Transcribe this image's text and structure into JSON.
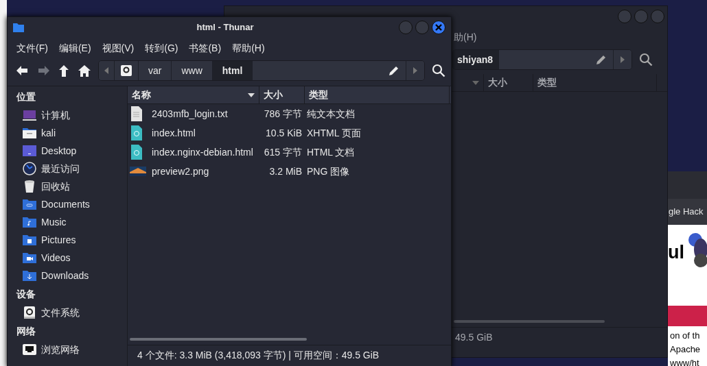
{
  "back_window": {
    "menu_item": "助(H)",
    "path_segment": "shiyan8",
    "columns": [
      "大小",
      "类型"
    ],
    "status": "49.5 GiB"
  },
  "browser_window": {
    "tab": "gle Hack",
    "heading": "ul",
    "lines": [
      "on of th",
      "Apache",
      "www/ht"
    ]
  },
  "window": {
    "title": "html - Thunar"
  },
  "menu": [
    "文件(F)",
    "编辑(E)",
    "视图(V)",
    "转到(G)",
    "书签(B)",
    "帮助(H)"
  ],
  "nav_buttons": [
    {
      "kind": "back",
      "disabled": false
    },
    {
      "kind": "forward",
      "disabled": true
    },
    {
      "kind": "up",
      "disabled": false
    },
    {
      "kind": "home",
      "disabled": false
    }
  ],
  "path": [
    {
      "kind": "drive",
      "selected": false
    },
    {
      "kind": "folder",
      "label": "var",
      "selected": false
    },
    {
      "kind": "folder",
      "label": "www",
      "selected": false
    },
    {
      "kind": "folder",
      "label": "html",
      "selected": true
    }
  ],
  "sidebar": [
    {
      "title": "位置",
      "items": [
        {
          "label": "计算机",
          "kind": "computer"
        },
        {
          "label": "kali",
          "kind": "home"
        },
        {
          "label": "Desktop",
          "kind": "desktop"
        },
        {
          "label": "最近访问",
          "kind": "recent"
        },
        {
          "label": "回收站",
          "kind": "trash"
        },
        {
          "label": "Documents",
          "kind": "documents"
        },
        {
          "label": "Music",
          "kind": "music"
        },
        {
          "label": "Pictures",
          "kind": "pictures"
        },
        {
          "label": "Videos",
          "kind": "videos"
        },
        {
          "label": "Downloads",
          "kind": "downloads"
        }
      ]
    },
    {
      "title": "设备",
      "items": [
        {
          "label": "文件系统",
          "kind": "drive"
        }
      ]
    },
    {
      "title": "网络",
      "items": [
        {
          "label": "浏览网络",
          "kind": "network"
        }
      ]
    }
  ],
  "columns": [
    {
      "label": "名称",
      "sorted": true
    },
    {
      "label": "大小",
      "sorted": false
    },
    {
      "label": "类型",
      "sorted": false
    }
  ],
  "rows": [
    {
      "name": "2403mfb_login.txt",
      "size": "786 字节",
      "type": "纯文本文档",
      "kind": "text"
    },
    {
      "name": "index.html",
      "size": "10.5 KiB",
      "type": "XHTML 页面",
      "kind": "html"
    },
    {
      "name": "index.nginx-debian.html",
      "size": "615 字节",
      "type": "HTML 文档",
      "kind": "html"
    },
    {
      "name": "preview2.png",
      "size": "3.2 MiB",
      "type": "PNG 图像",
      "kind": "image"
    }
  ],
  "status_bar": "4 个文件: 3.3 MiB (3,418,093 字节) | 可用空间：49.5 GiB"
}
